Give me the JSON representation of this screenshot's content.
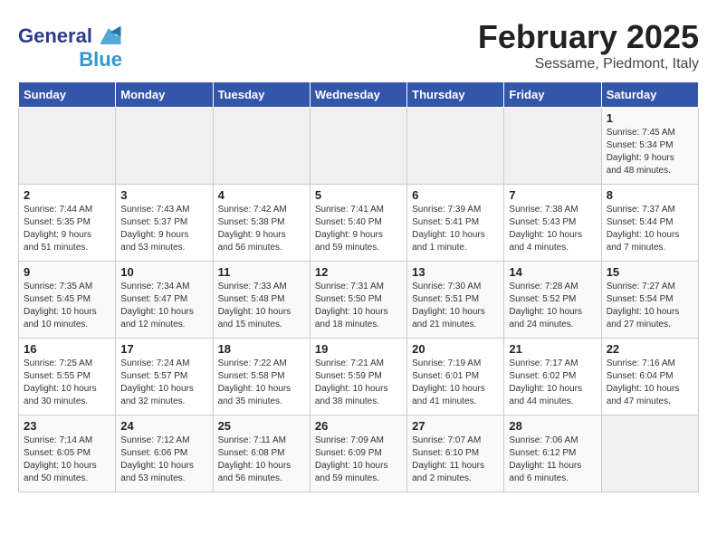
{
  "header": {
    "logo_line1": "General",
    "logo_line2": "Blue",
    "month": "February 2025",
    "location": "Sessame, Piedmont, Italy"
  },
  "days_of_week": [
    "Sunday",
    "Monday",
    "Tuesday",
    "Wednesday",
    "Thursday",
    "Friday",
    "Saturday"
  ],
  "weeks": [
    [
      {
        "day": "",
        "info": ""
      },
      {
        "day": "",
        "info": ""
      },
      {
        "day": "",
        "info": ""
      },
      {
        "day": "",
        "info": ""
      },
      {
        "day": "",
        "info": ""
      },
      {
        "day": "",
        "info": ""
      },
      {
        "day": "1",
        "info": "Sunrise: 7:45 AM\nSunset: 5:34 PM\nDaylight: 9 hours\nand 48 minutes."
      }
    ],
    [
      {
        "day": "2",
        "info": "Sunrise: 7:44 AM\nSunset: 5:35 PM\nDaylight: 9 hours\nand 51 minutes."
      },
      {
        "day": "3",
        "info": "Sunrise: 7:43 AM\nSunset: 5:37 PM\nDaylight: 9 hours\nand 53 minutes."
      },
      {
        "day": "4",
        "info": "Sunrise: 7:42 AM\nSunset: 5:38 PM\nDaylight: 9 hours\nand 56 minutes."
      },
      {
        "day": "5",
        "info": "Sunrise: 7:41 AM\nSunset: 5:40 PM\nDaylight: 9 hours\nand 59 minutes."
      },
      {
        "day": "6",
        "info": "Sunrise: 7:39 AM\nSunset: 5:41 PM\nDaylight: 10 hours\nand 1 minute."
      },
      {
        "day": "7",
        "info": "Sunrise: 7:38 AM\nSunset: 5:43 PM\nDaylight: 10 hours\nand 4 minutes."
      },
      {
        "day": "8",
        "info": "Sunrise: 7:37 AM\nSunset: 5:44 PM\nDaylight: 10 hours\nand 7 minutes."
      }
    ],
    [
      {
        "day": "9",
        "info": "Sunrise: 7:35 AM\nSunset: 5:45 PM\nDaylight: 10 hours\nand 10 minutes."
      },
      {
        "day": "10",
        "info": "Sunrise: 7:34 AM\nSunset: 5:47 PM\nDaylight: 10 hours\nand 12 minutes."
      },
      {
        "day": "11",
        "info": "Sunrise: 7:33 AM\nSunset: 5:48 PM\nDaylight: 10 hours\nand 15 minutes."
      },
      {
        "day": "12",
        "info": "Sunrise: 7:31 AM\nSunset: 5:50 PM\nDaylight: 10 hours\nand 18 minutes."
      },
      {
        "day": "13",
        "info": "Sunrise: 7:30 AM\nSunset: 5:51 PM\nDaylight: 10 hours\nand 21 minutes."
      },
      {
        "day": "14",
        "info": "Sunrise: 7:28 AM\nSunset: 5:52 PM\nDaylight: 10 hours\nand 24 minutes."
      },
      {
        "day": "15",
        "info": "Sunrise: 7:27 AM\nSunset: 5:54 PM\nDaylight: 10 hours\nand 27 minutes."
      }
    ],
    [
      {
        "day": "16",
        "info": "Sunrise: 7:25 AM\nSunset: 5:55 PM\nDaylight: 10 hours\nand 30 minutes."
      },
      {
        "day": "17",
        "info": "Sunrise: 7:24 AM\nSunset: 5:57 PM\nDaylight: 10 hours\nand 32 minutes."
      },
      {
        "day": "18",
        "info": "Sunrise: 7:22 AM\nSunset: 5:58 PM\nDaylight: 10 hours\nand 35 minutes."
      },
      {
        "day": "19",
        "info": "Sunrise: 7:21 AM\nSunset: 5:59 PM\nDaylight: 10 hours\nand 38 minutes."
      },
      {
        "day": "20",
        "info": "Sunrise: 7:19 AM\nSunset: 6:01 PM\nDaylight: 10 hours\nand 41 minutes."
      },
      {
        "day": "21",
        "info": "Sunrise: 7:17 AM\nSunset: 6:02 PM\nDaylight: 10 hours\nand 44 minutes."
      },
      {
        "day": "22",
        "info": "Sunrise: 7:16 AM\nSunset: 6:04 PM\nDaylight: 10 hours\nand 47 minutes."
      }
    ],
    [
      {
        "day": "23",
        "info": "Sunrise: 7:14 AM\nSunset: 6:05 PM\nDaylight: 10 hours\nand 50 minutes."
      },
      {
        "day": "24",
        "info": "Sunrise: 7:12 AM\nSunset: 6:06 PM\nDaylight: 10 hours\nand 53 minutes."
      },
      {
        "day": "25",
        "info": "Sunrise: 7:11 AM\nSunset: 6:08 PM\nDaylight: 10 hours\nand 56 minutes."
      },
      {
        "day": "26",
        "info": "Sunrise: 7:09 AM\nSunset: 6:09 PM\nDaylight: 10 hours\nand 59 minutes."
      },
      {
        "day": "27",
        "info": "Sunrise: 7:07 AM\nSunset: 6:10 PM\nDaylight: 11 hours\nand 2 minutes."
      },
      {
        "day": "28",
        "info": "Sunrise: 7:06 AM\nSunset: 6:12 PM\nDaylight: 11 hours\nand 6 minutes."
      },
      {
        "day": "",
        "info": ""
      }
    ]
  ]
}
